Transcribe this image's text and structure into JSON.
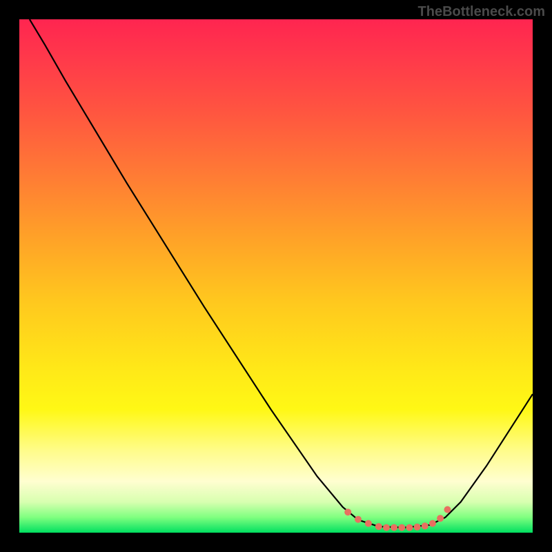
{
  "watermark": "TheBottleneck.com",
  "chart_data": {
    "type": "line",
    "title": "",
    "xlabel": "",
    "ylabel": "",
    "xlim": [
      0,
      100
    ],
    "ylim": [
      0,
      100
    ],
    "background_gradient": {
      "type": "vertical",
      "stops": [
        {
          "pos": 0,
          "color": "#ff2550"
        },
        {
          "pos": 100,
          "color": "#00e060"
        }
      ],
      "meaning": "red-high/bad to green-low/good"
    },
    "series": [
      {
        "name": "bottleneck-curve",
        "color": "#000000",
        "points": [
          {
            "x": 2,
            "y": 100
          },
          {
            "x": 5,
            "y": 95
          },
          {
            "x": 9,
            "y": 88
          },
          {
            "x": 21,
            "y": 68
          },
          {
            "x": 36,
            "y": 44
          },
          {
            "x": 49,
            "y": 24
          },
          {
            "x": 58,
            "y": 11
          },
          {
            "x": 63,
            "y": 5
          },
          {
            "x": 66,
            "y": 2.5
          },
          {
            "x": 70,
            "y": 1.2
          },
          {
            "x": 75,
            "y": 1
          },
          {
            "x": 80,
            "y": 1.5
          },
          {
            "x": 83,
            "y": 3
          },
          {
            "x": 86,
            "y": 6
          },
          {
            "x": 91,
            "y": 13
          },
          {
            "x": 100,
            "y": 27
          }
        ]
      },
      {
        "name": "optimal-markers",
        "color": "#e87060",
        "type": "scatter",
        "points": [
          {
            "x": 64,
            "y": 4
          },
          {
            "x": 66,
            "y": 2.6
          },
          {
            "x": 68,
            "y": 1.8
          },
          {
            "x": 70,
            "y": 1.2
          },
          {
            "x": 71.5,
            "y": 1
          },
          {
            "x": 73,
            "y": 1
          },
          {
            "x": 74.5,
            "y": 1
          },
          {
            "x": 76,
            "y": 1
          },
          {
            "x": 77.5,
            "y": 1.1
          },
          {
            "x": 79,
            "y": 1.3
          },
          {
            "x": 80.5,
            "y": 1.8
          },
          {
            "x": 82,
            "y": 2.8
          },
          {
            "x": 83.4,
            "y": 4.5
          }
        ]
      }
    ]
  }
}
